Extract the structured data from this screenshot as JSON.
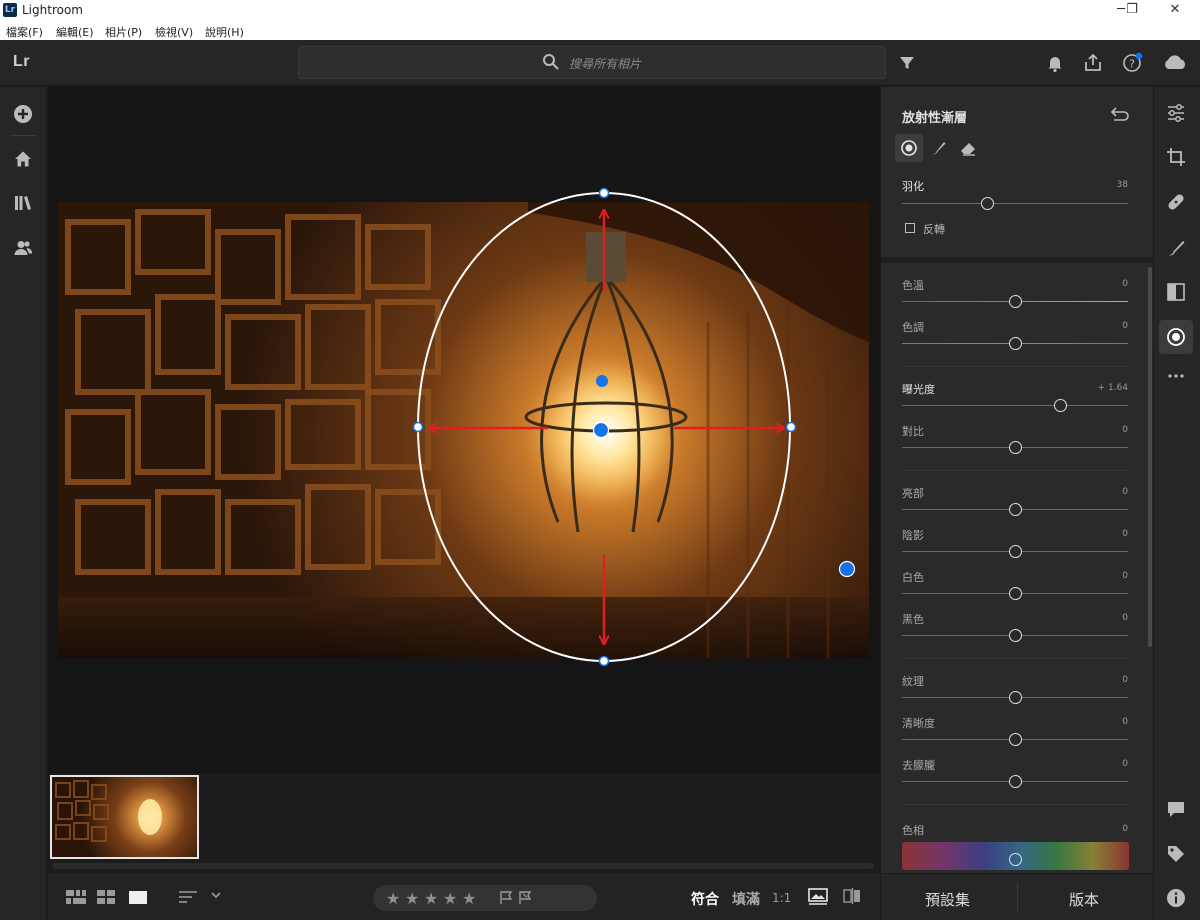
{
  "window": {
    "title": "Lightroom",
    "logo": "Lr",
    "controls": [
      "─",
      "❐",
      "✕"
    ]
  },
  "menu": [
    "檔案(F)",
    "編輯(E)",
    "相片(P)",
    "檢視(V)",
    "說明(H)"
  ],
  "toolbar": {
    "brand": "Lr",
    "search_placeholder": "搜尋所有相片",
    "icons": [
      "filter-icon",
      "bell-icon",
      "share-icon",
      "help-icon",
      "cloud-icon"
    ]
  },
  "left_rail": {
    "icons": [
      "add-photo-icon",
      "home-icon",
      "library-icon",
      "people-icon"
    ]
  },
  "bottom_bar": {
    "stars": [
      "★",
      "★",
      "★",
      "★",
      "★"
    ],
    "fit": "符合",
    "fill": "填滿",
    "one_to_one": "1:1"
  },
  "panel": {
    "title": "放射性漸層",
    "feather": {
      "label": "羽化",
      "value": "38",
      "fraction": 0.38
    },
    "invert_label": "反轉",
    "sliders": [
      {
        "label": "色溫",
        "value": "0",
        "fraction": 0.5
      },
      {
        "label": "色調",
        "value": "0",
        "fraction": 0.5
      },
      {
        "label": "曝光度",
        "value": "+ 1.64",
        "fraction": 0.7
      },
      {
        "label": "對比",
        "value": "0",
        "fraction": 0.5
      },
      {
        "label": "亮部",
        "value": "0",
        "fraction": 0.5
      },
      {
        "label": "陰影",
        "value": "0",
        "fraction": 0.5
      },
      {
        "label": "白色",
        "value": "0",
        "fraction": 0.5
      },
      {
        "label": "黑色",
        "value": "0",
        "fraction": 0.5
      },
      {
        "label": "紋理",
        "value": "0",
        "fraction": 0.5
      },
      {
        "label": "清晰度",
        "value": "0",
        "fraction": 0.5
      },
      {
        "label": "去朦朧",
        "value": "0",
        "fraction": 0.5
      }
    ],
    "hue": {
      "label": "色相",
      "value": "0",
      "fraction": 0.5
    },
    "presets_label": "預設集",
    "versions_label": "版本"
  },
  "right_rail": {
    "icons": [
      "edit-sliders-icon",
      "crop-icon",
      "healing-icon",
      "brush-icon",
      "linear-gradient-icon",
      "radial-gradient-icon",
      "more-icon",
      "comment-icon",
      "tag-icon",
      "info-icon"
    ]
  },
  "colors": {
    "accent": "#1473e6",
    "arrow": "#e02020",
    "app_bg": "#1e1e1e",
    "panel_bg": "#2a2a2a"
  }
}
